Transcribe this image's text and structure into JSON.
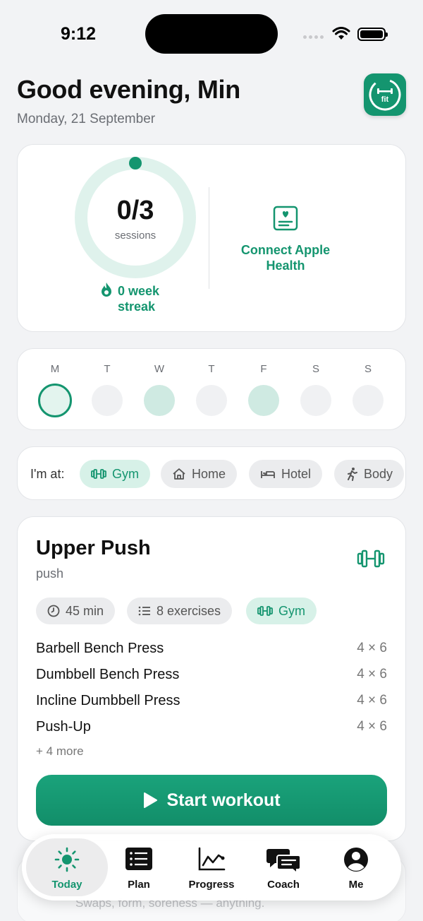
{
  "status": {
    "time": "9:12"
  },
  "header": {
    "greeting": "Good evening, Min",
    "date": "Monday, 21 September",
    "badge_text": "fit"
  },
  "summary": {
    "sessions_count": "0/3",
    "sessions_label": "sessions",
    "sessions_progress": 0,
    "streak_label": "0 week streak",
    "health_label": "Connect Apple Health"
  },
  "week": {
    "days": [
      {
        "letter": "M",
        "state": "today"
      },
      {
        "letter": "T",
        "state": "none"
      },
      {
        "letter": "W",
        "state": "done"
      },
      {
        "letter": "T",
        "state": "none"
      },
      {
        "letter": "F",
        "state": "done"
      },
      {
        "letter": "S",
        "state": "none"
      },
      {
        "letter": "S",
        "state": "none"
      }
    ]
  },
  "location": {
    "label": "I'm at:",
    "options": [
      {
        "label": "Gym",
        "icon": "dumbbell-icon",
        "active": true
      },
      {
        "label": "Home",
        "icon": "home-icon",
        "active": false
      },
      {
        "label": "Hotel",
        "icon": "bed-icon",
        "active": false
      },
      {
        "label": "Body",
        "icon": "person-icon",
        "active": false
      }
    ]
  },
  "workout": {
    "title": "Upper Push",
    "subtitle": "push",
    "duration": "45 min",
    "exercise_count": "8 exercises",
    "location": "Gym",
    "exercises": [
      {
        "name": "Barbell Bench Press",
        "sets": "4 × 6"
      },
      {
        "name": "Dumbbell Bench Press",
        "sets": "4 × 6"
      },
      {
        "name": "Incline Dumbbell Press",
        "sets": "4 × 6"
      },
      {
        "name": "Push-Up",
        "sets": "4 × 6"
      }
    ],
    "more": "+ 4 more",
    "start_label": "Start workout"
  },
  "coach_peek": {
    "text": "Swaps, form, soreness — anything."
  },
  "tabs": [
    {
      "label": "Today",
      "icon": "sun-icon",
      "active": true
    },
    {
      "label": "Plan",
      "icon": "list-icon",
      "active": false
    },
    {
      "label": "Progress",
      "icon": "chart-icon",
      "active": false
    },
    {
      "label": "Coach",
      "icon": "chat-icon",
      "active": false
    },
    {
      "label": "Me",
      "icon": "person-circle-icon",
      "active": false
    }
  ],
  "colors": {
    "accent": "#14956f",
    "accent_light": "#d7f1e8",
    "background": "#f2f3f5"
  }
}
